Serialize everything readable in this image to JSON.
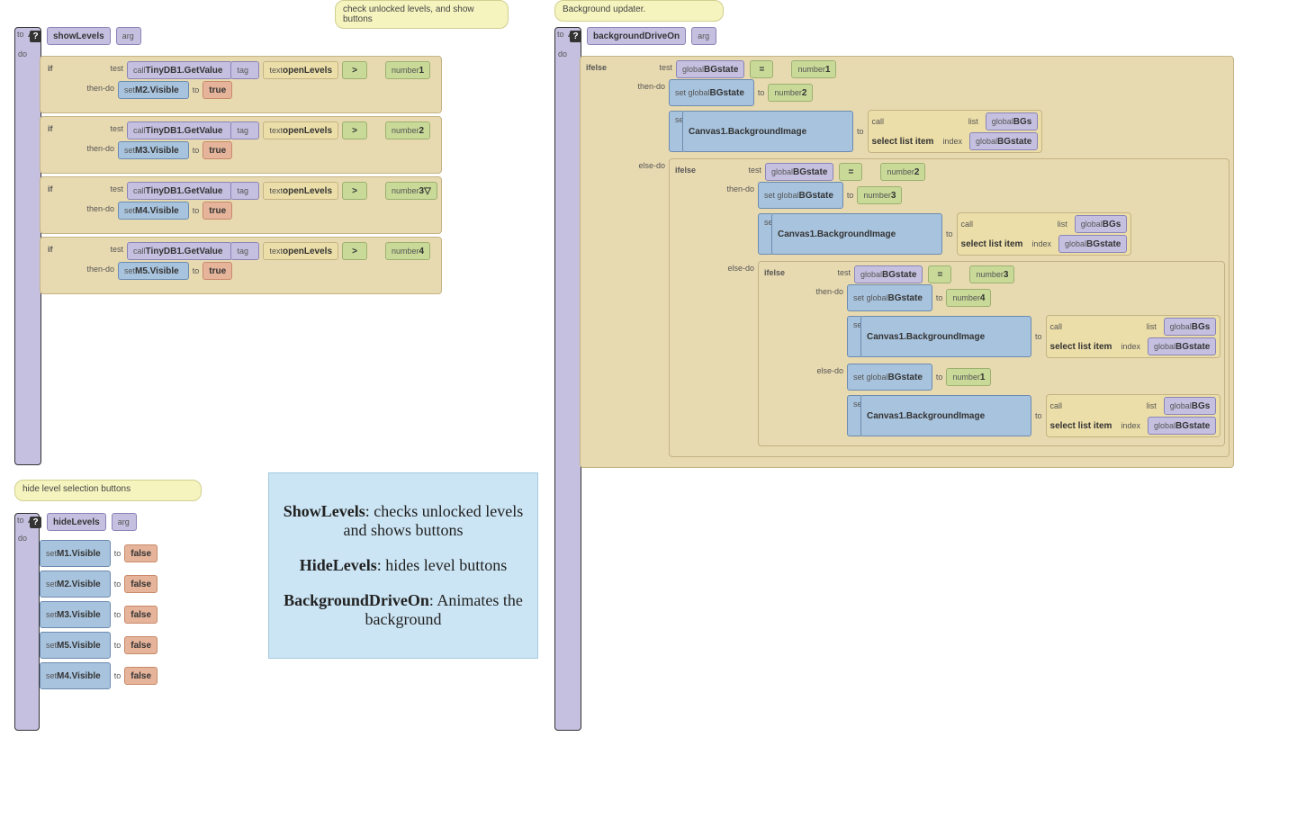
{
  "tooltips": {
    "t1": "check unlocked levels, and show buttons",
    "t2": "hide level selection buttons",
    "t3": "Background updater."
  },
  "kw": {
    "to": "to",
    "do": "do",
    "arg": "arg",
    "if": "if",
    "test": "test",
    "thendo": "then-do",
    "call": "call",
    "tag": "tag",
    "text": "text",
    "number": "number",
    "set": "set",
    "global": "global",
    "ifelse": "ifelse",
    "elsedo": "else-do",
    "setglobal": "set global",
    "list": "list",
    "index": "index",
    "gt": ">",
    "eq": "="
  },
  "proc": {
    "showLevels": "showLevels",
    "hideLevels": "hideLevels",
    "bgDrive": "backgroundDriveOn"
  },
  "names": {
    "tinydb": "TinyDB1.GetValue",
    "openLevels": "openLevels",
    "true": "true",
    "false": "false",
    "m1": "M1.Visible",
    "m2": "M2.Visible",
    "m3": "M3.Visible",
    "m4": "M4.Visible",
    "m5": "M5.Visible",
    "bgstate": "BGstate",
    "bgs": "BGs",
    "canvas": "Canvas1.BackgroundImage",
    "selectItem": "select list item"
  },
  "nums": {
    "n1": "1",
    "n2": "2",
    "n3": "3",
    "n3a": "3▽",
    "n4": "4"
  },
  "info": {
    "l1a": "ShowLevels",
    "l1b": ": checks unlocked levels and shows buttons",
    "l2a": "HideLevels",
    "l2b": ": hides level buttons",
    "l3a": "BackgroundDriveOn",
    "l3b": ": Animates the background"
  }
}
